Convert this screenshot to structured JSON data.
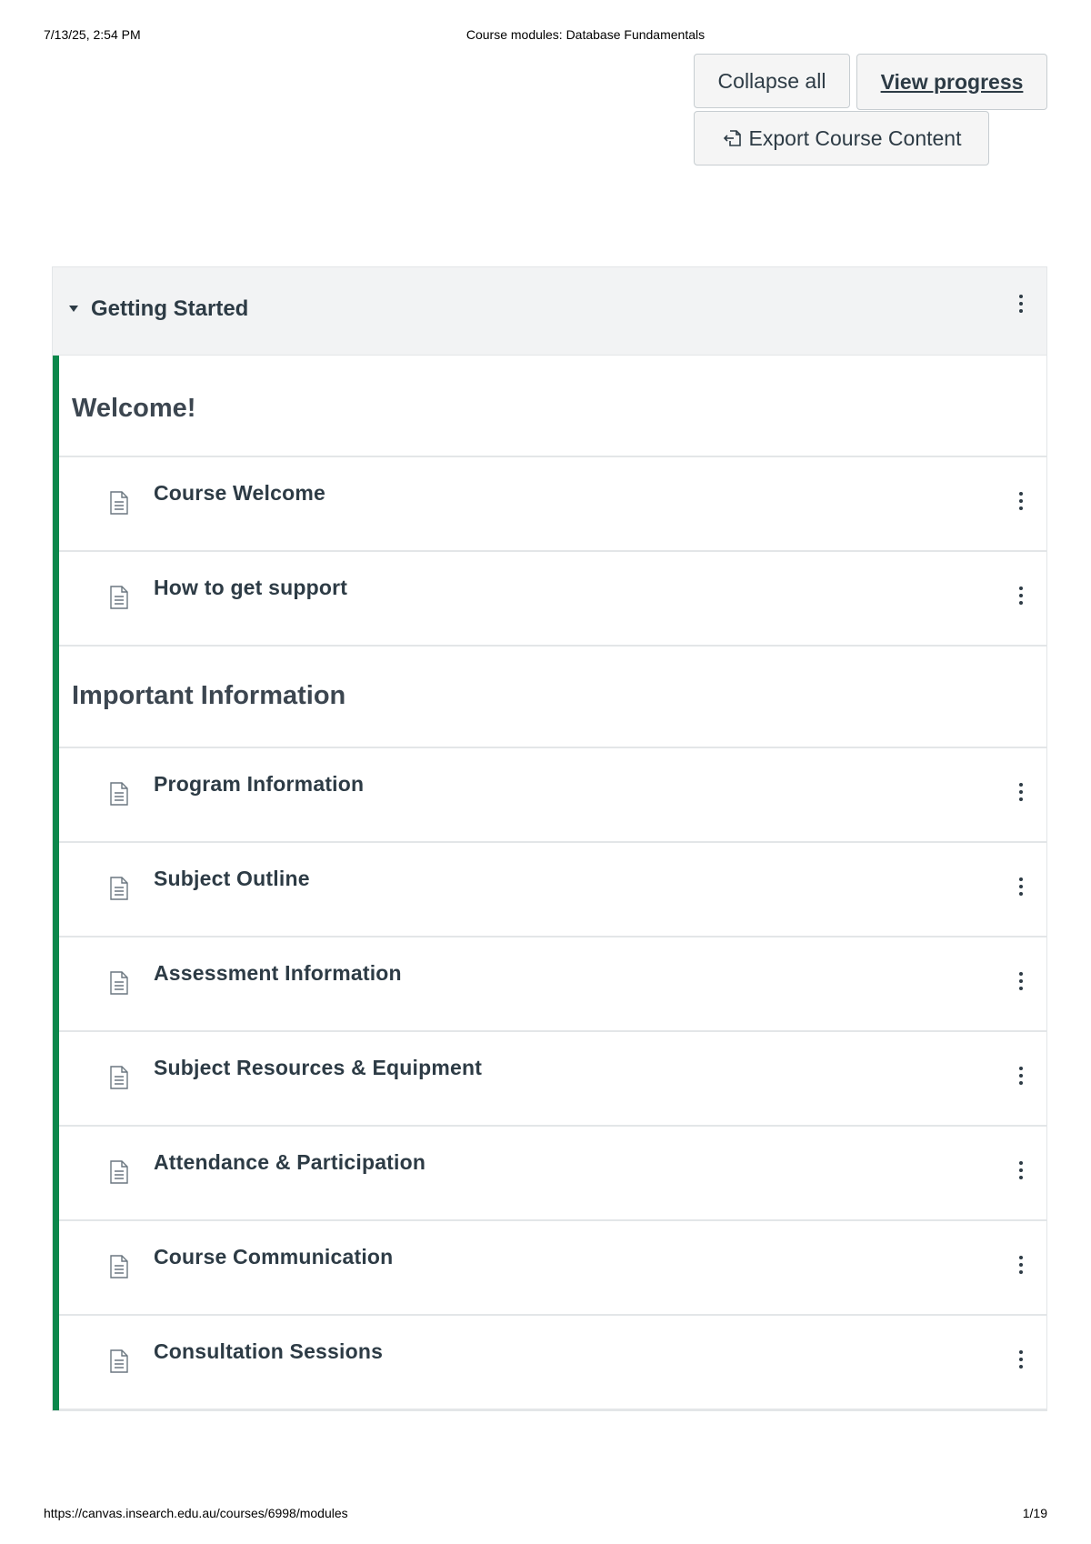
{
  "print_header": {
    "datetime": "7/13/25, 2:54 PM",
    "page_title": "Course modules: Database Fundamentals"
  },
  "toolbar": {
    "collapse_all_label": "Collapse all",
    "view_progress_label": "View progress",
    "export_label": "Export Course Content"
  },
  "module": {
    "title": "Getting Started",
    "expanded": true,
    "accent_color": "#0b874b",
    "sections": [
      {
        "heading": "Welcome!",
        "items": [
          {
            "label": "Course Welcome",
            "icon": "page-icon"
          },
          {
            "label": "How to get support",
            "icon": "page-icon"
          }
        ]
      },
      {
        "heading": "Important Information",
        "items": [
          {
            "label": "Program Information",
            "icon": "page-icon"
          },
          {
            "label": "Subject Outline",
            "icon": "page-icon"
          },
          {
            "label": "Assessment Information",
            "icon": "page-icon"
          },
          {
            "label": "Subject Resources & Equipment",
            "icon": "page-icon"
          },
          {
            "label": "Attendance & Participation",
            "icon": "page-icon"
          },
          {
            "label": "Course Communication",
            "icon": "page-icon"
          },
          {
            "label": "Consultation Sessions",
            "icon": "page-icon"
          }
        ]
      }
    ]
  },
  "print_footer": {
    "url": "https://canvas.insearch.edu.au/courses/6998/modules",
    "page_number": "1/19"
  }
}
